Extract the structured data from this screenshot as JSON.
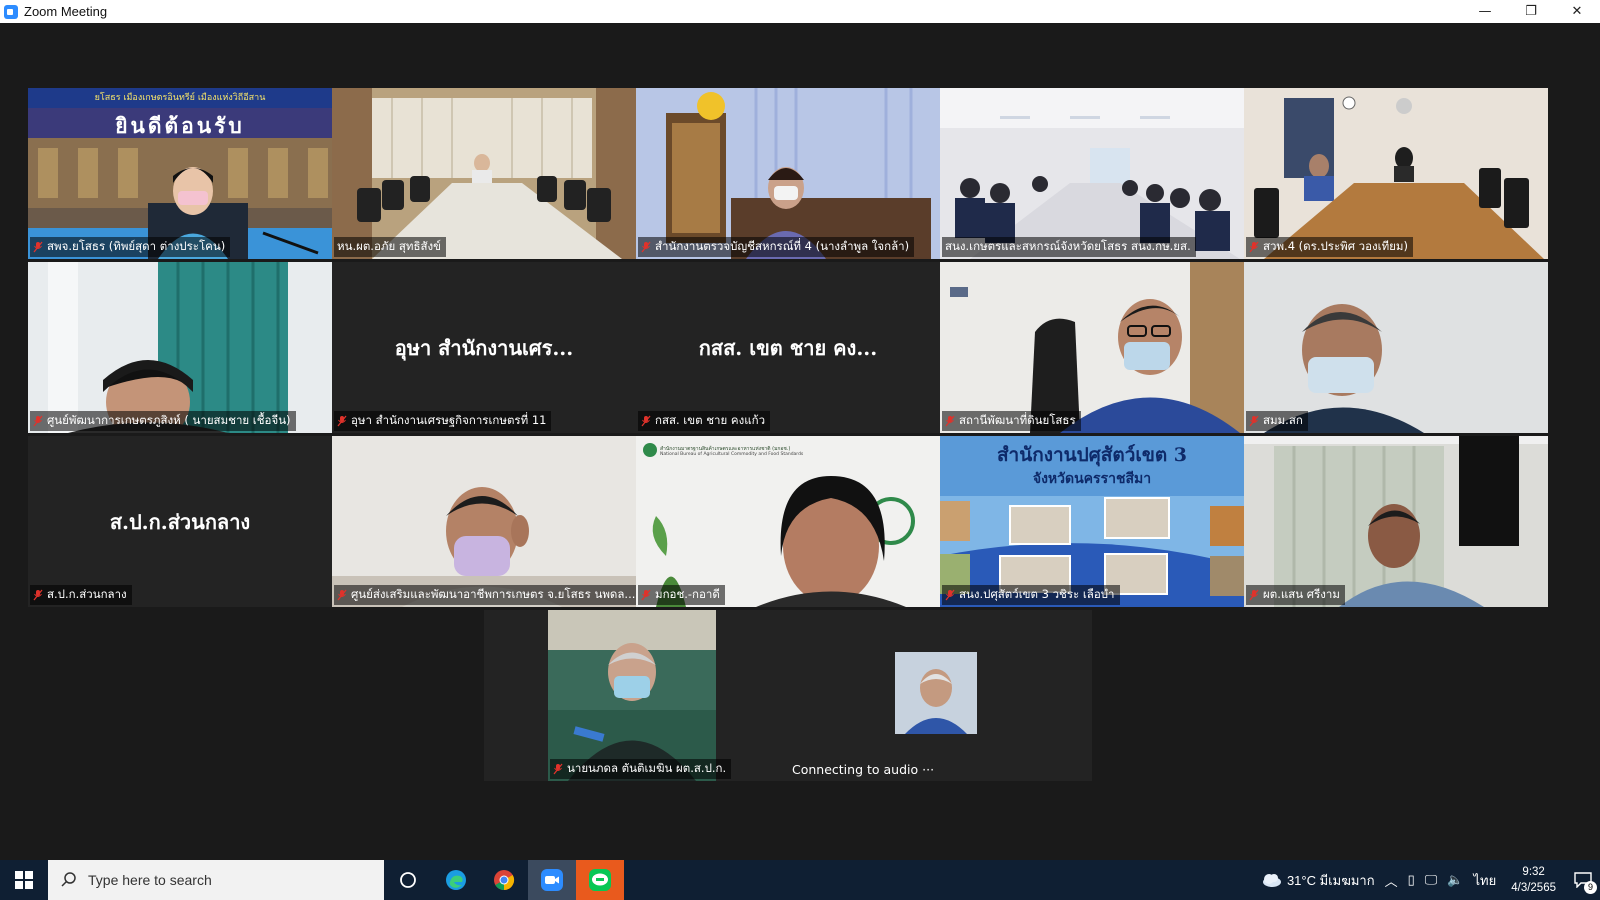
{
  "window": {
    "title": "Zoom Meeting",
    "minimize": "—",
    "restore": "❐",
    "close": "✕"
  },
  "participants": [
    {
      "label": "สพจ.ยโสธร (ทิพย์สุดา ต่างประโคน)",
      "muted": true,
      "video": true,
      "banner_top": "ยโสธร เมืองเกษตรอินทรีย์ เมืองแห่งวิถีอีสาน",
      "banner_main": "ยินดีต้อนรับ"
    },
    {
      "label": "หน.ผต.อภัย สุทธิสังข์",
      "muted": false,
      "video": true,
      "active": true
    },
    {
      "label": "สำนักงานตรวจบัญชีสหกรณ์ที่ 4 (นางลำพูล ใจกล้า)",
      "muted": true,
      "video": true
    },
    {
      "label": "สนง.เกษตรและสหกรณ์จังหวัดยโสธร สนง.กษ.ยส.",
      "muted": false,
      "video": true
    },
    {
      "label": "สวพ.4 (ดร.ประพิศ วองเทียม)",
      "muted": true,
      "video": true
    },
    {
      "label": "ศูนย์พัฒนาการเกษตรภูสิงห์ ( นายสมชาย เชื้อจีน)",
      "muted": true,
      "video": true
    },
    {
      "label": "อุษา สำนักงานเศรษฐกิจการเกษตรที่ 11",
      "muted": true,
      "video": false,
      "display_name": "อุษา สำนักงานเศร..."
    },
    {
      "label": "กสส. เขต ชาย คงแก้ว",
      "muted": true,
      "video": false,
      "display_name": "กสส. เขต ชาย คง..."
    },
    {
      "label": "สถานีพัฒนาที่ดินยโสธร",
      "muted": true,
      "video": true
    },
    {
      "label": "สมม.สก",
      "muted": true,
      "video": true
    },
    {
      "label": "ส.ป.ก.ส่วนกลาง",
      "muted": true,
      "video": false,
      "display_name": "ส.ป.ก.ส่วนกลาง"
    },
    {
      "label": "ศูนย์ส่งเสริมและพัฒนาอาชีพการเกษตร จ.ยโสธร นพดล...",
      "muted": true,
      "video": true
    },
    {
      "label": "มกอช.-กอาดี",
      "muted": true,
      "video": true,
      "logo_text": "สำนักงานมาตรฐานสินค้าเกษตรและอาหารแห่งชาติ (มกอช.)",
      "logo_sub": "National Bureau of Agricultural Commodity and Food Standards"
    },
    {
      "label": "สนง.ปศุสัตว์เขต 3 วชิระ เลือบำ",
      "muted": true,
      "video": true,
      "banner_main": "สำนักงานปศุสัตว์เขต 3",
      "banner_sub": "จังหวัดนครราชสีมา"
    },
    {
      "label": "ผต.แสน ศรีงาม",
      "muted": true,
      "video": true
    },
    {
      "label": "นายนภดล ตันติเมฆิน ผต.ส.ป.ก.",
      "muted": true,
      "video": true
    },
    {
      "label": "Connecting to audio ···",
      "muted": false,
      "video": true,
      "connecting": true
    }
  ],
  "taskbar": {
    "search_placeholder": "Type here to search",
    "weather": "31°C มีเมฆมาก",
    "language": "ไทย",
    "time": "9:32",
    "date": "4/3/2565",
    "notifications": "9"
  },
  "colors": {
    "active_border": "#d6e25a",
    "muted_mic": "#e0322b",
    "taskbar": "#0f1f33"
  }
}
